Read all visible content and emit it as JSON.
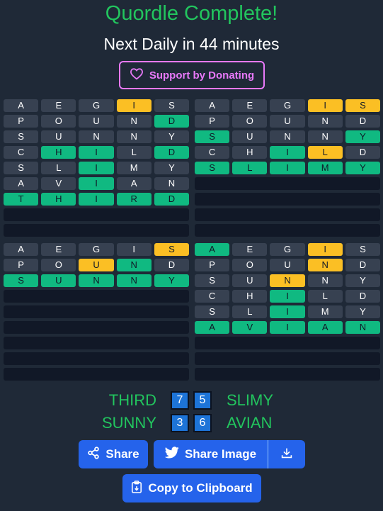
{
  "header": {
    "title": "Quordle Complete!",
    "subtitle": "Next Daily in 44 minutes",
    "donate_label": "Support by Donating"
  },
  "boards": [
    {
      "rows": [
        [
          [
            "A",
            "gray"
          ],
          [
            "E",
            "gray"
          ],
          [
            "G",
            "gray"
          ],
          [
            "I",
            "yellow"
          ],
          [
            "S",
            "gray"
          ]
        ],
        [
          [
            "P",
            "gray"
          ],
          [
            "O",
            "gray"
          ],
          [
            "U",
            "gray"
          ],
          [
            "N",
            "gray"
          ],
          [
            "D",
            "green"
          ]
        ],
        [
          [
            "S",
            "gray"
          ],
          [
            "U",
            "gray"
          ],
          [
            "N",
            "gray"
          ],
          [
            "N",
            "gray"
          ],
          [
            "Y",
            "gray"
          ]
        ],
        [
          [
            "C",
            "gray"
          ],
          [
            "H",
            "green"
          ],
          [
            "I",
            "green"
          ],
          [
            "L",
            "gray"
          ],
          [
            "D",
            "green"
          ]
        ],
        [
          [
            "S",
            "gray"
          ],
          [
            "L",
            "gray"
          ],
          [
            "I",
            "green"
          ],
          [
            "M",
            "gray"
          ],
          [
            "Y",
            "gray"
          ]
        ],
        [
          [
            "A",
            "gray"
          ],
          [
            "V",
            "gray"
          ],
          [
            "I",
            "green"
          ],
          [
            "A",
            "gray"
          ],
          [
            "N",
            "gray"
          ]
        ],
        [
          [
            "T",
            "green"
          ],
          [
            "H",
            "green"
          ],
          [
            "I",
            "green"
          ],
          [
            "R",
            "green"
          ],
          [
            "D",
            "green"
          ]
        ]
      ],
      "blank_rows": 2
    },
    {
      "rows": [
        [
          [
            "A",
            "gray"
          ],
          [
            "E",
            "gray"
          ],
          [
            "G",
            "gray"
          ],
          [
            "I",
            "yellow"
          ],
          [
            "S",
            "yellow"
          ]
        ],
        [
          [
            "P",
            "gray"
          ],
          [
            "O",
            "gray"
          ],
          [
            "U",
            "gray"
          ],
          [
            "N",
            "gray"
          ],
          [
            "D",
            "gray"
          ]
        ],
        [
          [
            "S",
            "green"
          ],
          [
            "U",
            "gray"
          ],
          [
            "N",
            "gray"
          ],
          [
            "N",
            "gray"
          ],
          [
            "Y",
            "green"
          ]
        ],
        [
          [
            "C",
            "gray"
          ],
          [
            "H",
            "gray"
          ],
          [
            "I",
            "green"
          ],
          [
            "L",
            "yellow"
          ],
          [
            "D",
            "gray"
          ]
        ],
        [
          [
            "S",
            "green"
          ],
          [
            "L",
            "green"
          ],
          [
            "I",
            "green"
          ],
          [
            "M",
            "green"
          ],
          [
            "Y",
            "green"
          ]
        ]
      ],
      "blank_rows": 4
    },
    {
      "rows": [
        [
          [
            "A",
            "gray"
          ],
          [
            "E",
            "gray"
          ],
          [
            "G",
            "gray"
          ],
          [
            "I",
            "gray"
          ],
          [
            "S",
            "yellow"
          ]
        ],
        [
          [
            "P",
            "gray"
          ],
          [
            "O",
            "gray"
          ],
          [
            "U",
            "yellow"
          ],
          [
            "N",
            "green"
          ],
          [
            "D",
            "gray"
          ]
        ],
        [
          [
            "S",
            "green"
          ],
          [
            "U",
            "green"
          ],
          [
            "N",
            "green"
          ],
          [
            "N",
            "green"
          ],
          [
            "Y",
            "green"
          ]
        ]
      ],
      "blank_rows": 6
    },
    {
      "rows": [
        [
          [
            "A",
            "green"
          ],
          [
            "E",
            "gray"
          ],
          [
            "G",
            "gray"
          ],
          [
            "I",
            "yellow"
          ],
          [
            "S",
            "gray"
          ]
        ],
        [
          [
            "P",
            "gray"
          ],
          [
            "O",
            "gray"
          ],
          [
            "U",
            "gray"
          ],
          [
            "N",
            "yellow"
          ],
          [
            "D",
            "gray"
          ]
        ],
        [
          [
            "S",
            "gray"
          ],
          [
            "U",
            "gray"
          ],
          [
            "N",
            "yellow"
          ],
          [
            "N",
            "gray"
          ],
          [
            "Y",
            "gray"
          ]
        ],
        [
          [
            "C",
            "gray"
          ],
          [
            "H",
            "gray"
          ],
          [
            "I",
            "green"
          ],
          [
            "L",
            "gray"
          ],
          [
            "D",
            "gray"
          ]
        ],
        [
          [
            "S",
            "gray"
          ],
          [
            "L",
            "gray"
          ],
          [
            "I",
            "green"
          ],
          [
            "M",
            "gray"
          ],
          [
            "Y",
            "gray"
          ]
        ],
        [
          [
            "A",
            "green"
          ],
          [
            "V",
            "green"
          ],
          [
            "I",
            "green"
          ],
          [
            "A",
            "green"
          ],
          [
            "N",
            "green"
          ]
        ]
      ],
      "blank_rows": 3
    }
  ],
  "results": {
    "row1": {
      "left_word": "THIRD",
      "left_count": "7",
      "right_count": "5",
      "right_word": "SLIMY"
    },
    "row2": {
      "left_word": "SUNNY",
      "left_count": "3",
      "right_count": "6",
      "right_word": "AVIAN"
    }
  },
  "buttons": {
    "share_label": "Share",
    "share_image_label": "Share Image",
    "clipboard_label": "Copy to Clipboard"
  },
  "colors": {
    "title": "#22c55e",
    "green": "#10b981",
    "yellow": "#fbbf24",
    "gray": "#374151",
    "donate": "#e879f9",
    "button": "#2563eb",
    "count_box": "#1d74d8"
  },
  "icons": {
    "donate": "heart-icon",
    "share": "share-nodes-icon",
    "share_image": "twitter-bird-icon",
    "download": "download-icon",
    "clipboard": "clipboard-icon"
  }
}
